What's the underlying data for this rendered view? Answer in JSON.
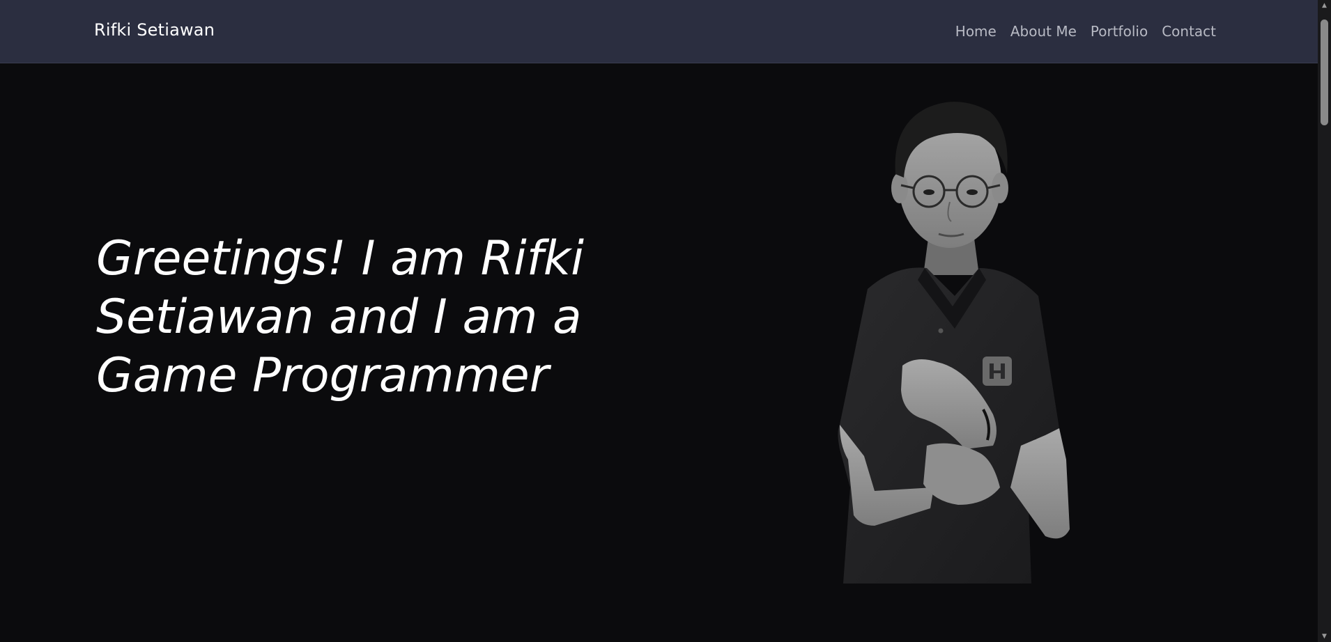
{
  "navbar": {
    "brand": "Rifki Setiawan",
    "links": [
      "Home",
      "About Me",
      "Portfolio",
      "Contact"
    ]
  },
  "hero": {
    "heading": "Greetings! I am Rifki Setiawan and I am a Game Programmer",
    "portrait_description": "portrait-photo"
  },
  "colors": {
    "navbar_bg": "#2b2e40",
    "page_bg": "#0b0b0d",
    "text": "#ffffff",
    "nav_link": "#b8bac4"
  },
  "icons": {
    "scroll_up": "scroll-up-arrow-icon",
    "scroll_down": "scroll-down-arrow-icon"
  }
}
